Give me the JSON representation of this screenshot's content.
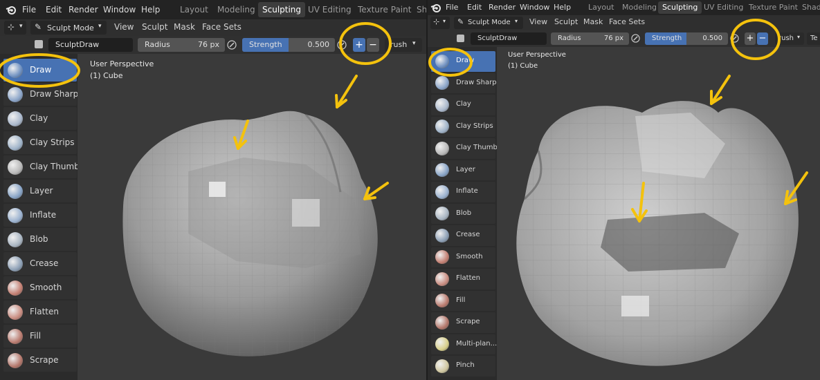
{
  "menu": [
    "File",
    "Edit",
    "Render",
    "Window",
    "Help"
  ],
  "workspace_tabs_left": [
    "Layout",
    "Modeling",
    "Sculpting",
    "UV Editing",
    "Texture Paint",
    "Sh"
  ],
  "workspace_tabs_right": [
    "Layout",
    "Modeling",
    "Sculpting",
    "UV Editing",
    "Texture Paint",
    "Shadi"
  ],
  "active_tab": "Sculpting",
  "header": {
    "mode": "Sculpt Mode",
    "items": [
      "View",
      "Sculpt",
      "Mask",
      "Face Sets"
    ]
  },
  "toolbar": {
    "brush_name": "SculptDraw",
    "radius_label": "Radius",
    "radius_value": "76 px",
    "strength_label": "Strength",
    "strength_value": "0.500",
    "plus": "+",
    "minus": "−",
    "brush_menu_left": "rush",
    "brush_menu_right": "rush",
    "overflow_right": "Te"
  },
  "tools_left": [
    "Draw",
    "Draw Sharp",
    "Clay",
    "Clay Strips",
    "Clay Thumb",
    "Layer",
    "Inflate",
    "Blob",
    "Crease",
    "Smooth",
    "Flatten",
    "Fill",
    "Scrape"
  ],
  "tools_right": [
    "Draw",
    "Draw Sharp",
    "Clay",
    "Clay Strips",
    "Clay Thumb",
    "Layer",
    "Inflate",
    "Blob",
    "Crease",
    "Smooth",
    "Flatten",
    "Fill",
    "Scrape",
    "Multi-plan...",
    "Pinch"
  ],
  "active_tool": "Draw",
  "viewport_info": {
    "line1": "User Perspective",
    "line2": "(1) Cube"
  },
  "colors": {
    "accent": "#4772b3",
    "highlight": "#f4c20d"
  },
  "icons": {
    "tool": "brush-icon",
    "mode": "sculpt-mode-icon",
    "logo": "blender-logo-icon"
  }
}
